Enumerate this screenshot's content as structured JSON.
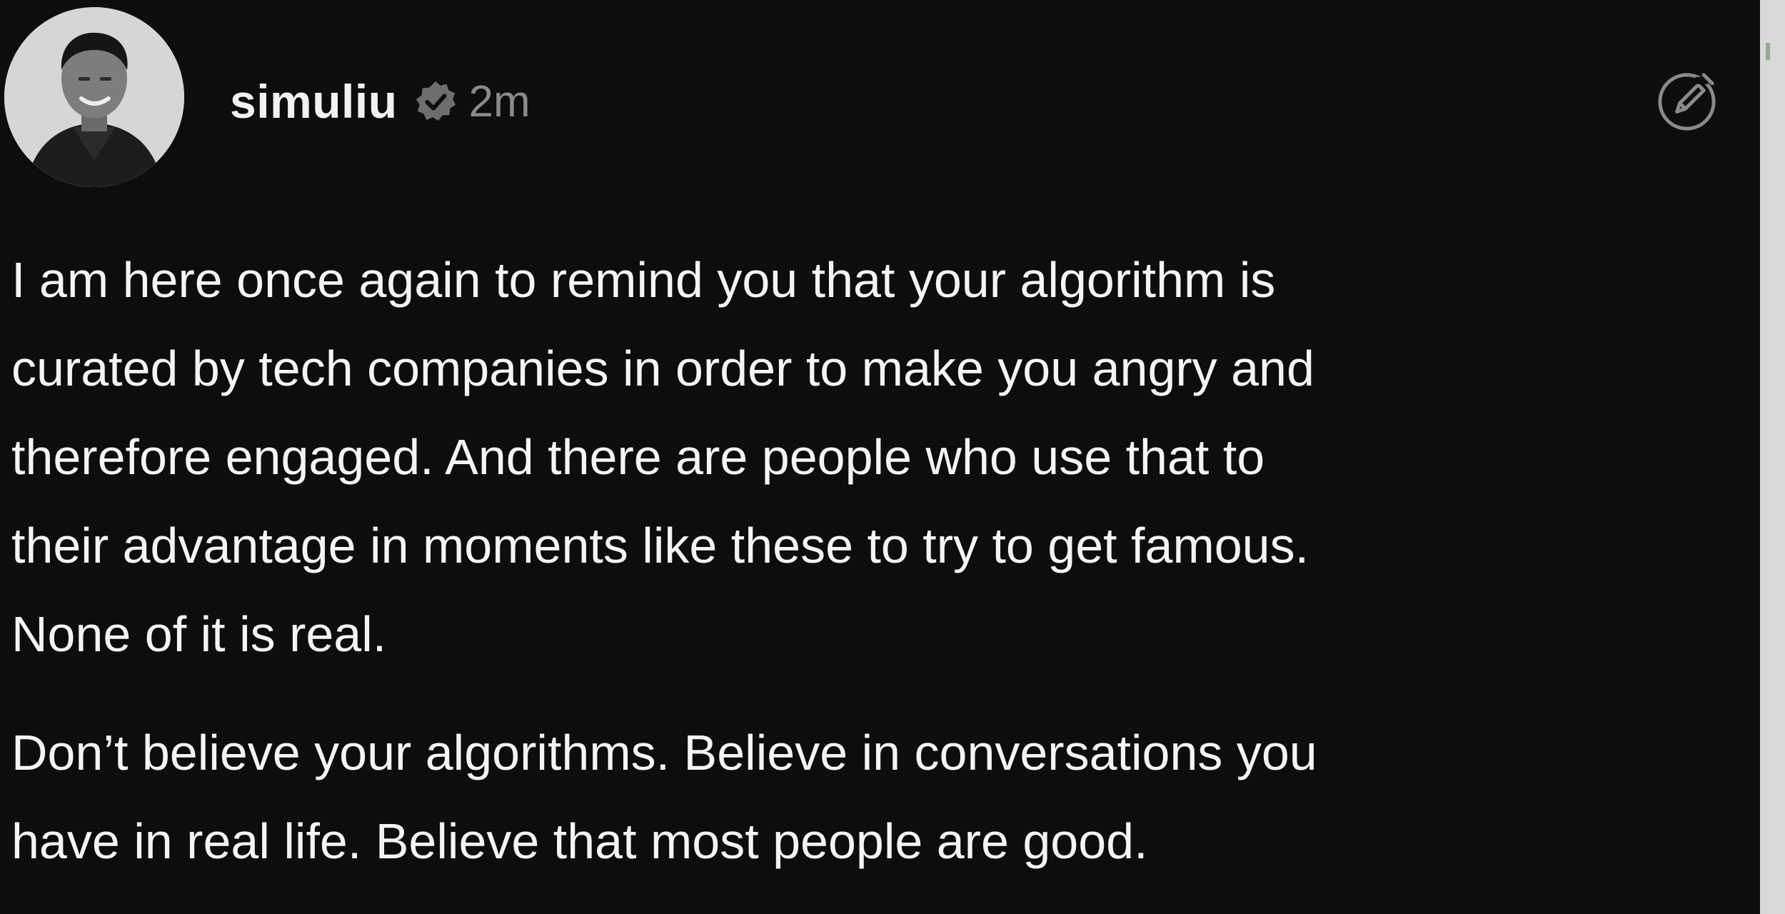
{
  "post": {
    "username": "simuliu",
    "timestamp": "2m",
    "paragraphs": [
      "I am here once again to remind you that your algorithm is\ncurated by tech companies in order to make you angry and\ntherefore engaged. And there are people who use that to\ntheir advantage in moments like these to try to get famous.\nNone of it is real.",
      "Don’t believe your algorithms. Believe in conversations you\nhave in real life. Believe that most people are good."
    ]
  },
  "icons": {
    "avatar": "profile-photo",
    "verified": "verified-badge-icon",
    "edit": "edit-icon"
  },
  "colors": {
    "background": "#0d0d0d",
    "text": "#f4f4f4",
    "muted": "#8a8a8a",
    "badge": "#6e6e6e"
  }
}
